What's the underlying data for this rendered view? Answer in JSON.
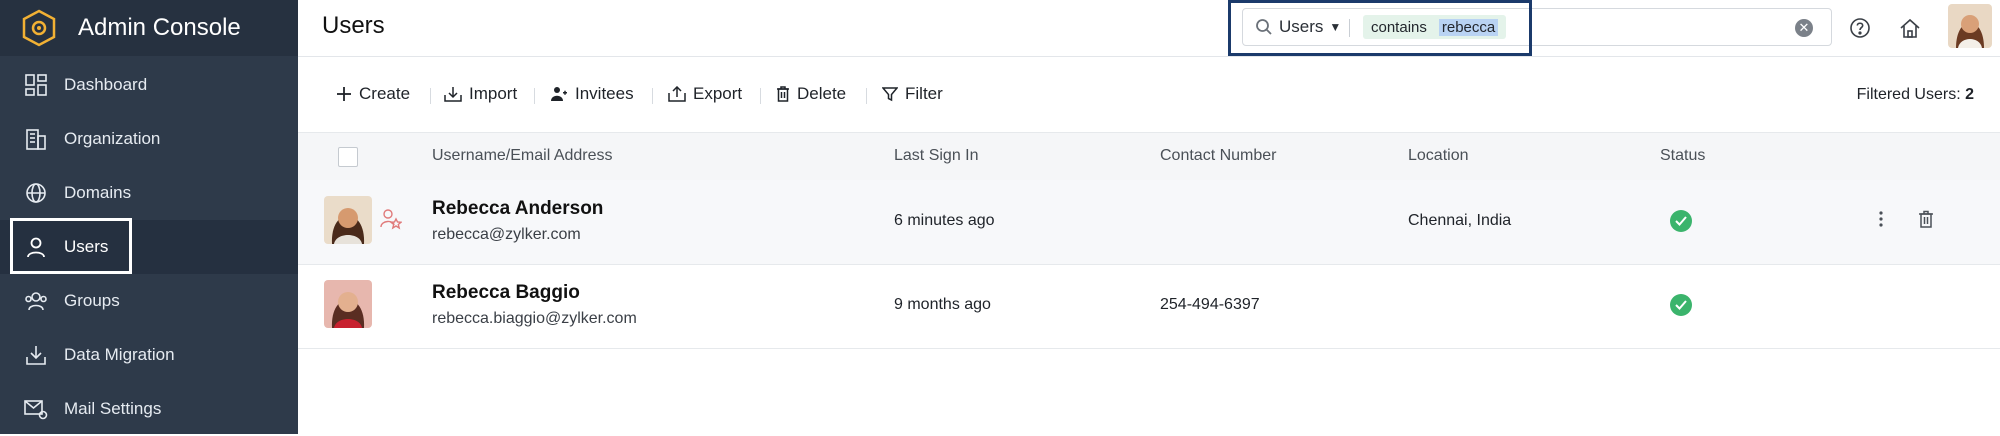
{
  "app": {
    "title": "Admin Console"
  },
  "sidebar": {
    "items": [
      {
        "label": "Dashboard",
        "icon": "dashboard-icon"
      },
      {
        "label": "Organization",
        "icon": "building-icon"
      },
      {
        "label": "Domains",
        "icon": "globe-icon"
      },
      {
        "label": "Users",
        "icon": "user-icon",
        "active": true
      },
      {
        "label": "Groups",
        "icon": "groups-icon"
      },
      {
        "label": "Data Migration",
        "icon": "download-icon"
      },
      {
        "label": "Mail Settings",
        "icon": "mail-settings-icon"
      }
    ]
  },
  "header": {
    "page_title": "Users",
    "search": {
      "scope": "Users",
      "operator": "contains",
      "value": "rebecca"
    }
  },
  "toolbar": {
    "create": "Create",
    "import": "Import",
    "invitees": "Invitees",
    "export": "Export",
    "delete": "Delete",
    "filter": "Filter",
    "filtered_label": "Filtered Users: ",
    "filtered_count": "2"
  },
  "table": {
    "columns": [
      "Username/Email Address",
      "Last Sign In",
      "Contact Number",
      "Location",
      "Status"
    ],
    "rows": [
      {
        "name": "Rebecca Anderson",
        "email": "rebecca@zylker.com",
        "last_sign_in": "6 minutes ago",
        "contact": "",
        "location": "Chennai, India",
        "status": "active"
      },
      {
        "name": "Rebecca Baggio",
        "email": "rebecca.biaggio@zylker.com",
        "last_sign_in": "9 months ago",
        "contact": "254-494-6397",
        "location": "",
        "status": "active"
      }
    ]
  },
  "colors": {
    "sidebar_bg": "#2e3a4a",
    "status_green": "#3bb46c",
    "highlight_border": "#1b3a6b"
  }
}
